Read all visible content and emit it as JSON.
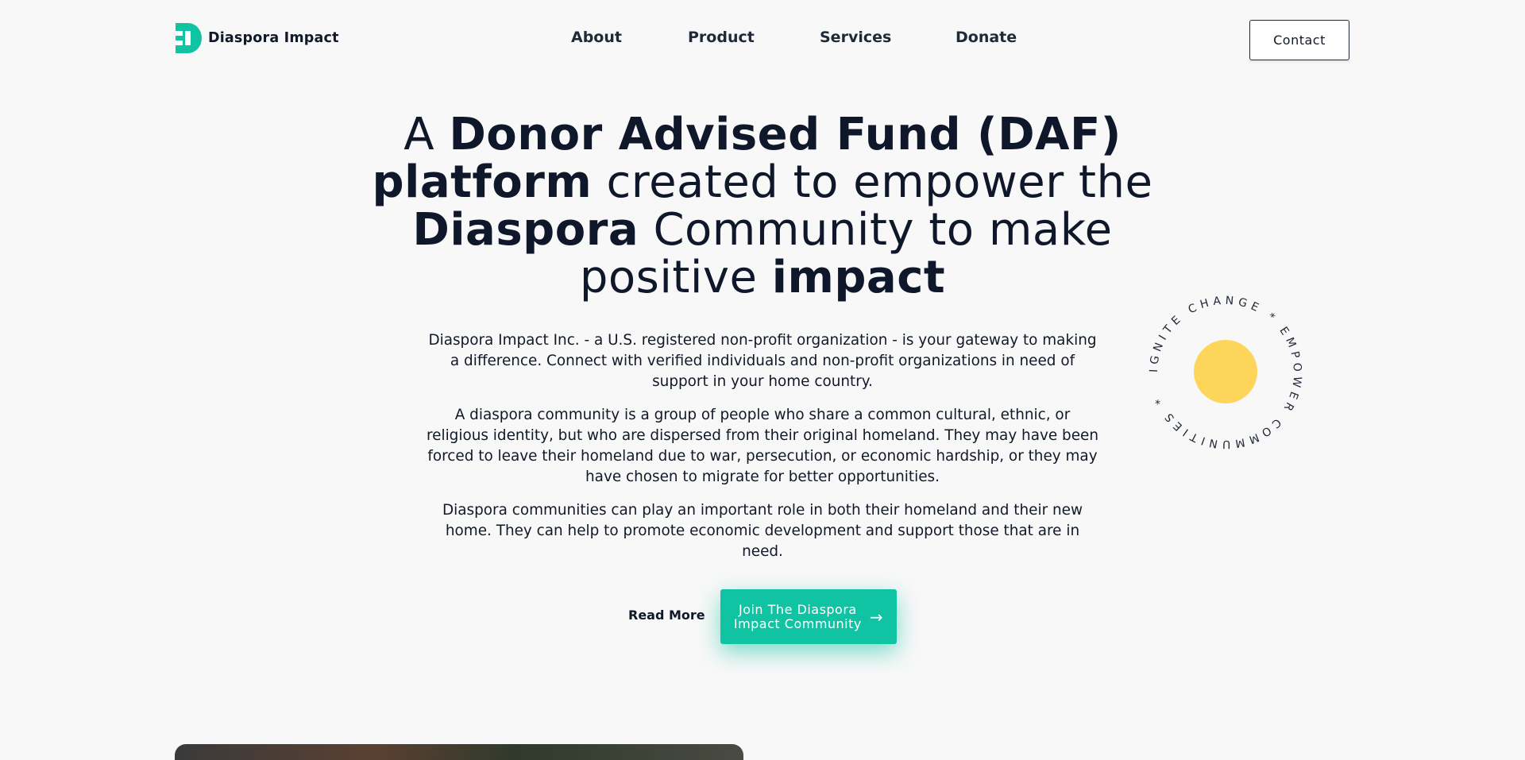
{
  "brand": {
    "name": "Diaspora Impact",
    "accent_color": "#10c3a3",
    "logo_icon": "d-monogram-icon"
  },
  "nav": {
    "items": [
      "About",
      "Product",
      "Services",
      "Donate"
    ]
  },
  "header": {
    "contact_label": "Contact"
  },
  "hero": {
    "title_parts": [
      "A ",
      "Donor Advised Fund (DAF)",
      "platform",
      " created to empower the",
      "Diaspora",
      " Community to make",
      "positive ",
      "impact"
    ],
    "paragraphs": [
      "Diaspora Impact Inc. - a U.S. registered non-profit organization - is your gateway to making a difference. Connect with verified individuals and non-profit organizations in need of support in your home country.",
      "A diaspora community is a group of people who share a common cultural, ethnic, or religious identity, but who are dispersed from their original homeland. They may have been forced to leave their homeland due to war, persecution, or economic hardship, or they may have chosen to migrate for better opportunities.",
      "Diaspora communities can play an important role in both their homeland and their new home. They can help to promote economic development and support those that are in need."
    ],
    "read_more_label": "Read More",
    "join_label_line1": "Join The Diaspora",
    "join_label_line2": "Impact Community",
    "join_icon": "arrow-right-icon"
  },
  "badge": {
    "text": "IGNITE CHANGE * EMPOWER COMMUNITIES * ",
    "circle_color": "#fdd55b"
  }
}
